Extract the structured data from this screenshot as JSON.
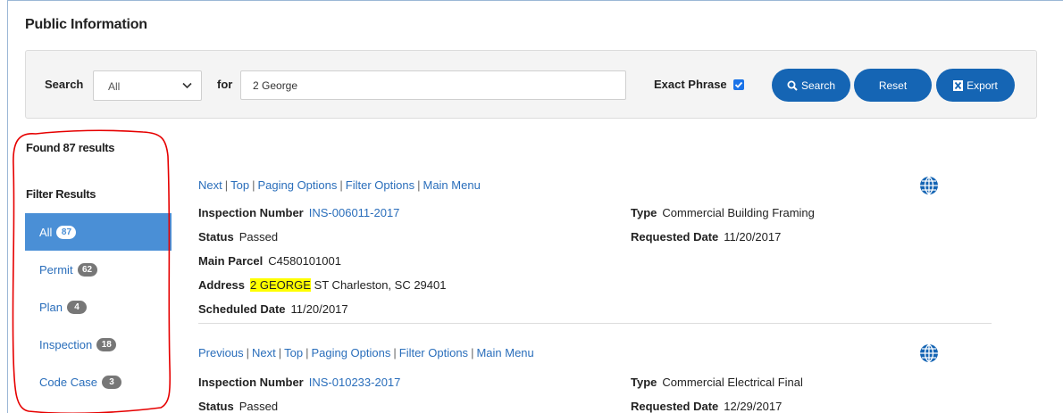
{
  "page": {
    "title": "Public Information"
  },
  "search": {
    "label": "Search",
    "category": "All",
    "for_label": "for",
    "query": "2 George",
    "exact_label": "Exact Phrase",
    "exact_checked": true,
    "buttons": {
      "search": "Search",
      "reset": "Reset",
      "export": "Export"
    }
  },
  "results": {
    "found_text": "Found 87 results",
    "filter_title": "Filter Results"
  },
  "filters": [
    {
      "label": "All",
      "count": "87",
      "active": true
    },
    {
      "label": "Permit",
      "count": "62",
      "active": false
    },
    {
      "label": "Plan",
      "count": "4",
      "active": false
    },
    {
      "label": "Inspection",
      "count": "18",
      "active": false
    },
    {
      "label": "Code Case",
      "count": "3",
      "active": false
    }
  ],
  "records": [
    {
      "links": [
        "Next",
        "Top",
        "Paging Options",
        "Filter Options",
        "Main Menu"
      ],
      "inspection_number_label": "Inspection Number",
      "inspection_number": "INS-006011-2017",
      "status_label": "Status",
      "status": "Passed",
      "main_parcel_label": "Main Parcel",
      "main_parcel": "C4580101001",
      "address_label": "Address",
      "address_highlight": "2 GEORGE",
      "address_rest": " ST Charleston, SC 29401",
      "scheduled_label": "Scheduled Date",
      "scheduled": "11/20/2017",
      "type_label": "Type",
      "type": "Commercial Building Framing",
      "requested_label": "Requested Date",
      "requested": "11/20/2017"
    },
    {
      "links": [
        "Previous",
        "Next",
        "Top",
        "Paging Options",
        "Filter Options",
        "Main Menu"
      ],
      "inspection_number_label": "Inspection Number",
      "inspection_number": "INS-010233-2017",
      "status_label": "Status",
      "status": "Passed",
      "type_label": "Type",
      "type": "Commercial Electrical Final",
      "requested_label": "Requested Date",
      "requested": "12/29/2017"
    }
  ],
  "colors": {
    "accent": "#1565b4",
    "link": "#2a6ebb",
    "active_filter": "#4a8fd6",
    "highlight": "#ffff00",
    "annotation": "#e60000"
  }
}
